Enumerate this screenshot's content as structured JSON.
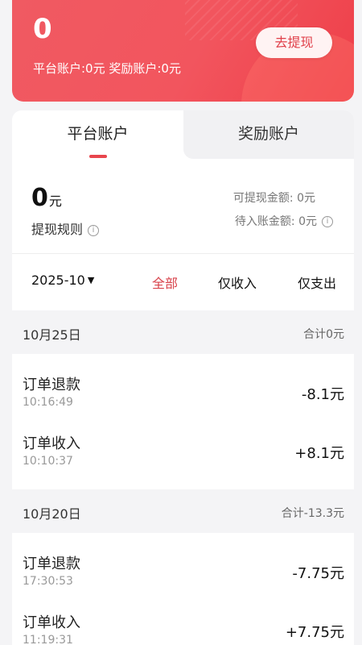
{
  "header": {
    "balance": "0",
    "account_line": "平台账户:0元 奖励账户:0元",
    "withdraw_label": "去提现"
  },
  "tabs": [
    {
      "label": "平台账户",
      "active": true
    },
    {
      "label": "奖励账户",
      "active": false
    }
  ],
  "summary": {
    "amount": "0",
    "unit": "元",
    "rules_label": "提现规则",
    "withdrawable": "可提现金额: 0元",
    "pending": "待入账金额: 0元"
  },
  "filters": {
    "month": "2025-10",
    "all": "全部",
    "income": "仅收入",
    "expense": "仅支出",
    "active": "全部"
  },
  "groups": [
    {
      "date": "10月25日",
      "total": "合计0元",
      "items": [
        {
          "title": "订单退款",
          "time": "10:16:49",
          "amount": "-8.1元"
        },
        {
          "title": "订单收入",
          "time": "10:10:37",
          "amount": "+8.1元"
        }
      ]
    },
    {
      "date": "10月20日",
      "total": "合计-13.3元",
      "items": [
        {
          "title": "订单退款",
          "time": "17:30:53",
          "amount": "-7.75元"
        },
        {
          "title": "订单收入",
          "time": "11:19:31",
          "amount": "+7.75元"
        }
      ]
    }
  ],
  "colors": {
    "accent": "#e8454d",
    "header_bg": "#f2555e",
    "page_bg": "#f4f4f6"
  }
}
